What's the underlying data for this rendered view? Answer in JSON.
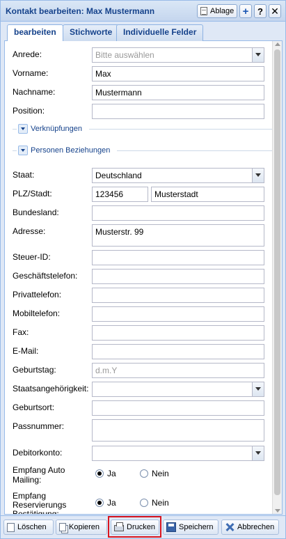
{
  "window": {
    "title": "Kontakt bearbeiten: Max Mustermann"
  },
  "title_tools": {
    "ablage_label": "Ablage",
    "add_label": "+",
    "help_label": "?",
    "close_label": "✕"
  },
  "tabs": [
    {
      "label": "bearbeiten",
      "active": true
    },
    {
      "label": "Stichworte",
      "active": false
    },
    {
      "label": "Individuelle Felder",
      "active": false
    }
  ],
  "form": {
    "anrede": {
      "label": "Anrede:",
      "placeholder": "Bitte auswählen"
    },
    "vorname": {
      "label": "Vorname:",
      "value": "Max"
    },
    "nachname": {
      "label": "Nachname:",
      "value": "Mustermann"
    },
    "position": {
      "label": "Position:",
      "value": ""
    },
    "verknuepfungen": {
      "legend": "Verknüpfungen"
    },
    "beziehungen": {
      "legend": "Personen Beziehungen"
    },
    "staat": {
      "label": "Staat:",
      "value": "Deutschland"
    },
    "plz_stadt": {
      "label": "PLZ/Stadt:",
      "plz": "123456",
      "stadt": "Musterstadt"
    },
    "bundesland": {
      "label": "Bundesland:",
      "value": ""
    },
    "adresse": {
      "label": "Adresse:",
      "value": "Musterstr. 99"
    },
    "steuer_id": {
      "label": "Steuer-ID:",
      "value": ""
    },
    "geschaeftstelefon": {
      "label": "Geschäftstelefon:",
      "value": ""
    },
    "privattelefon": {
      "label": "Privattelefon:",
      "value": ""
    },
    "mobiltelefon": {
      "label": "Mobiltelefon:",
      "value": ""
    },
    "fax": {
      "label": "Fax:",
      "value": ""
    },
    "email": {
      "label": "E-Mail:",
      "value": ""
    },
    "geburtstag": {
      "label": "Geburtstag:",
      "placeholder": "d.m.Y"
    },
    "staatsangehoerigkeit": {
      "label": "Staatsangehörigkeit:",
      "value": ""
    },
    "geburtsort": {
      "label": "Geburtsort:",
      "value": ""
    },
    "passnummer": {
      "label": "Passnummer:",
      "value": ""
    },
    "debitorkonto": {
      "label": "Debitorkonto:",
      "value": ""
    },
    "empfang_auto_mailing": {
      "label_line1": "Empfang Auto",
      "label_line2": "Mailing:",
      "yes": "Ja",
      "no": "Nein",
      "selected": "Ja"
    },
    "empfang_reservierung": {
      "label_line1": "Empfang",
      "label_line2": "Reservierungs",
      "label_line3": "Bestätigung:",
      "yes": "Ja",
      "no": "Nein",
      "selected": "Ja"
    }
  },
  "buttons": {
    "loeschen": "Löschen",
    "kopieren": "Kopieren",
    "drucken": "Drucken",
    "speichern": "Speichern",
    "abbrechen": "Abbrechen"
  },
  "colors": {
    "title": "#15428b",
    "frame": "#99bbe8",
    "highlight": "#d9151f"
  }
}
